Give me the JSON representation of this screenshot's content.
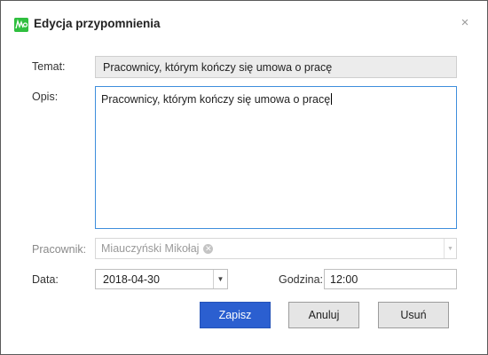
{
  "window": {
    "title": "Edycja przypomnienia",
    "close_glyph": "×",
    "icon": "reminder-app-icon"
  },
  "form": {
    "subject_label": "Temat:",
    "subject_value": "Pracownicy, którym kończy się umowa o pracę",
    "description_label": "Opis:",
    "description_value": "Pracownicy, którym kończy się umowa o pracę",
    "employee_label": "Pracownik:",
    "employee_tag": "Miauczyński Mikołaj",
    "date_label": "Data:",
    "date_value": "2018-04-30",
    "time_label": "Godzina:",
    "time_value": "12:00"
  },
  "buttons": {
    "save": "Zapisz",
    "cancel": "Anuluj",
    "delete": "Usuń"
  },
  "colors": {
    "primary_button": "#2b5fd0",
    "focus_border": "#3e8edc",
    "app_icon": "#2fbf3f"
  }
}
